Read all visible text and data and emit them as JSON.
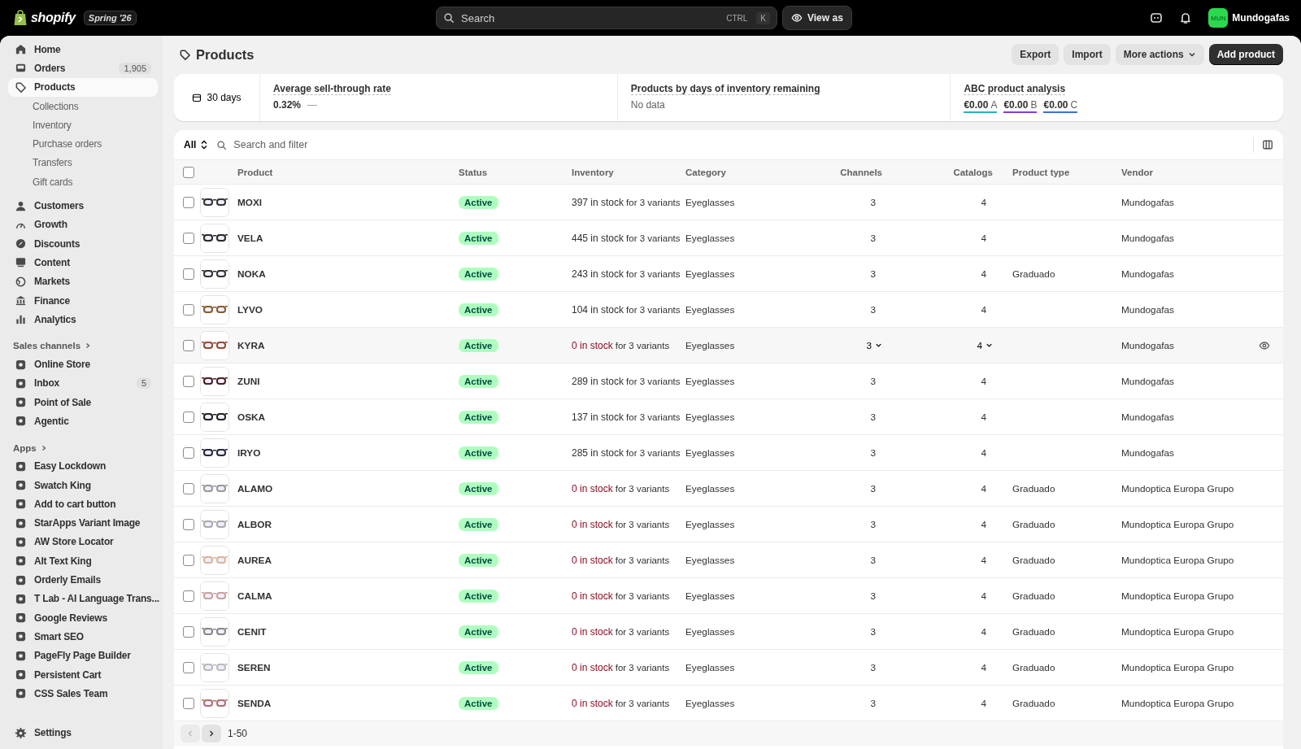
{
  "topbar": {
    "logo": "shopify",
    "edition": "Spring '26",
    "search": {
      "placeholder": "Search",
      "keys": [
        "CTRL",
        "K"
      ]
    },
    "view_as": "View as",
    "store": {
      "initials": "MUN",
      "name": "Mundogafas"
    }
  },
  "sidebar": {
    "items": [
      {
        "label": "Home",
        "selected": false
      },
      {
        "label": "Orders",
        "badge": "1,905",
        "selected": false
      },
      {
        "label": "Products",
        "selected": true,
        "children": [
          {
            "label": "Collections",
            "selected": false
          },
          {
            "label": "Inventory",
            "selected": false
          },
          {
            "label": "Purchase orders",
            "selected": false
          },
          {
            "label": "Transfers",
            "selected": false
          },
          {
            "label": "Gift cards",
            "selected": false
          }
        ]
      },
      {
        "label": "Customers",
        "selected": false
      },
      {
        "label": "Growth",
        "selected": false
      },
      {
        "label": "Discounts",
        "selected": false
      },
      {
        "label": "Content",
        "selected": false
      },
      {
        "label": "Markets",
        "selected": false
      },
      {
        "label": "Finance",
        "selected": false
      },
      {
        "label": "Analytics",
        "selected": false
      }
    ],
    "sales_channels": {
      "title": "Sales channels",
      "items": [
        {
          "label": "Online Store",
          "selected": false
        },
        {
          "label": "Inbox",
          "badge": "5",
          "selected": false
        },
        {
          "label": "Point of Sale",
          "selected": false
        },
        {
          "label": "Agentic",
          "selected": false
        }
      ]
    },
    "apps": {
      "title": "Apps",
      "items": [
        {
          "label": "Easy Lockdown",
          "selected": false
        },
        {
          "label": "Swatch King",
          "selected": false
        },
        {
          "label": "Add to cart button",
          "selected": false
        },
        {
          "label": "StarApps Variant Image",
          "selected": false
        },
        {
          "label": "AW Store Locator",
          "selected": false
        },
        {
          "label": "Alt Text King",
          "selected": false
        },
        {
          "label": "Orderly Emails",
          "selected": false
        },
        {
          "label": "T Lab - AI Language Trans...",
          "selected": false
        },
        {
          "label": "Google Reviews",
          "selected": false
        },
        {
          "label": "Smart SEO",
          "selected": false
        },
        {
          "label": "PageFly Page Builder",
          "selected": false
        },
        {
          "label": "Persistent Cart",
          "selected": false
        },
        {
          "label": "CSS Sales Team",
          "selected": false
        }
      ]
    },
    "settings": "Settings"
  },
  "page": {
    "title": "Products",
    "actions": [
      {
        "label": "Export",
        "primary": false,
        "menu": false
      },
      {
        "label": "Import",
        "primary": false,
        "menu": false
      },
      {
        "label": "More actions",
        "primary": false,
        "menu": true
      },
      {
        "label": "Add product",
        "primary": true,
        "menu": false
      }
    ]
  },
  "stats": {
    "period": "30 days",
    "metrics": [
      {
        "title": "Average sell-through rate",
        "value": "0.32%",
        "trend": "—"
      },
      {
        "title": "Products by days of inventory remaining",
        "value": "No data"
      },
      {
        "title": "ABC product analysis",
        "grades": [
          {
            "value": "€0.00",
            "grade": "A",
            "color": "#27b3b9"
          },
          {
            "value": "€0.00",
            "grade": "B",
            "color": "#7a3ee8"
          },
          {
            "value": "€0.00",
            "grade": "C",
            "color": "#3b6fe0"
          }
        ]
      }
    ]
  },
  "table": {
    "filter": "All",
    "select_all": false,
    "search_placeholder": "Search and filter",
    "columns": [
      "Product",
      "Status",
      "Inventory",
      "Category",
      "Channels",
      "Catalogs",
      "Product type",
      "Vendor"
    ],
    "rows": [
      {
        "product": "MOXI",
        "status": "Active",
        "stock": "397 in stock",
        "variants": "for 3 variants",
        "out_of_stock": false,
        "category": "Eyeglasses",
        "channels": "3",
        "catalogs": "4",
        "vendor": "Mundogafas",
        "hovered": false,
        "selected": false
      },
      {
        "product": "VELA",
        "status": "Active",
        "stock": "445 in stock",
        "variants": "for 3 variants",
        "out_of_stock": false,
        "category": "Eyeglasses",
        "channels": "3",
        "catalogs": "4",
        "vendor": "Mundogafas",
        "hovered": false,
        "selected": false
      },
      {
        "product": "NOKA",
        "status": "Active",
        "stock": "243 in stock",
        "variants": "for 3 variants",
        "out_of_stock": false,
        "category": "Eyeglasses",
        "channels": "3",
        "catalogs": "4",
        "product_type": "Graduado",
        "vendor": "Mundogafas",
        "hovered": false,
        "selected": false
      },
      {
        "product": "LYVO",
        "status": "Active",
        "stock": "104 in stock",
        "variants": "for 3 variants",
        "out_of_stock": false,
        "category": "Eyeglasses",
        "channels": "3",
        "catalogs": "4",
        "vendor": "Mundogafas",
        "hovered": false,
        "selected": false
      },
      {
        "product": "KYRA",
        "status": "Active",
        "stock": "0 in stock",
        "variants": "for 3 variants",
        "out_of_stock": true,
        "category": "Eyeglasses",
        "channels": "3",
        "catalogs": "4",
        "vendor": "Mundogafas",
        "hovered": true,
        "selected": false
      },
      {
        "product": "ZUNI",
        "status": "Active",
        "stock": "289 in stock",
        "variants": "for 3 variants",
        "out_of_stock": false,
        "category": "Eyeglasses",
        "channels": "3",
        "catalogs": "4",
        "vendor": "Mundogafas",
        "hovered": false,
        "selected": false
      },
      {
        "product": "OSKA",
        "status": "Active",
        "stock": "137 in stock",
        "variants": "for 3 variants",
        "out_of_stock": false,
        "category": "Eyeglasses",
        "channels": "3",
        "catalogs": "4",
        "vendor": "Mundogafas",
        "hovered": false,
        "selected": false
      },
      {
        "product": "IRYO",
        "status": "Active",
        "stock": "285 in stock",
        "variants": "for 3 variants",
        "out_of_stock": false,
        "category": "Eyeglasses",
        "channels": "3",
        "catalogs": "4",
        "vendor": "Mundogafas",
        "hovered": false,
        "selected": false
      },
      {
        "product": "ALAMO",
        "status": "Active",
        "stock": "0 in stock",
        "variants": "for 3 variants",
        "out_of_stock": true,
        "category": "Eyeglasses",
        "channels": "3",
        "catalogs": "4",
        "product_type": "Graduado",
        "vendor": "Mundoptica Europa Grupo",
        "hovered": false,
        "selected": false
      },
      {
        "product": "ALBOR",
        "status": "Active",
        "stock": "0 in stock",
        "variants": "for 3 variants",
        "out_of_stock": true,
        "category": "Eyeglasses",
        "channels": "3",
        "catalogs": "4",
        "product_type": "Graduado",
        "vendor": "Mundoptica Europa Grupo",
        "hovered": false,
        "selected": false
      },
      {
        "product": "AUREA",
        "status": "Active",
        "stock": "0 in stock",
        "variants": "for 3 variants",
        "out_of_stock": true,
        "category": "Eyeglasses",
        "channels": "3",
        "catalogs": "4",
        "product_type": "Graduado",
        "vendor": "Mundoptica Europa Grupo",
        "hovered": false,
        "selected": false
      },
      {
        "product": "CALMA",
        "status": "Active",
        "stock": "0 in stock",
        "variants": "for 3 variants",
        "out_of_stock": true,
        "category": "Eyeglasses",
        "channels": "3",
        "catalogs": "4",
        "product_type": "Graduado",
        "vendor": "Mundoptica Europa Grupo",
        "hovered": false,
        "selected": false
      },
      {
        "product": "CENIT",
        "status": "Active",
        "stock": "0 in stock",
        "variants": "for 3 variants",
        "out_of_stock": true,
        "category": "Eyeglasses",
        "channels": "3",
        "catalogs": "4",
        "product_type": "Graduado",
        "vendor": "Mundoptica Europa Grupo",
        "hovered": false,
        "selected": false
      },
      {
        "product": "SEREN",
        "status": "Active",
        "stock": "0 in stock",
        "variants": "for 3 variants",
        "out_of_stock": true,
        "category": "Eyeglasses",
        "channels": "3",
        "catalogs": "4",
        "product_type": "Graduado",
        "vendor": "Mundoptica Europa Grupo",
        "hovered": false,
        "selected": false
      },
      {
        "product": "SENDA",
        "status": "Active",
        "stock": "0 in stock",
        "variants": "for 3 variants",
        "out_of_stock": true,
        "category": "Eyeglasses",
        "channels": "3",
        "catalogs": "4",
        "product_type": "Graduado",
        "vendor": "Mundoptica Europa Grupo",
        "hovered": false,
        "selected": false
      }
    ],
    "pagination": {
      "range": "1-50",
      "previous_disabled": true,
      "next_disabled": false
    }
  }
}
